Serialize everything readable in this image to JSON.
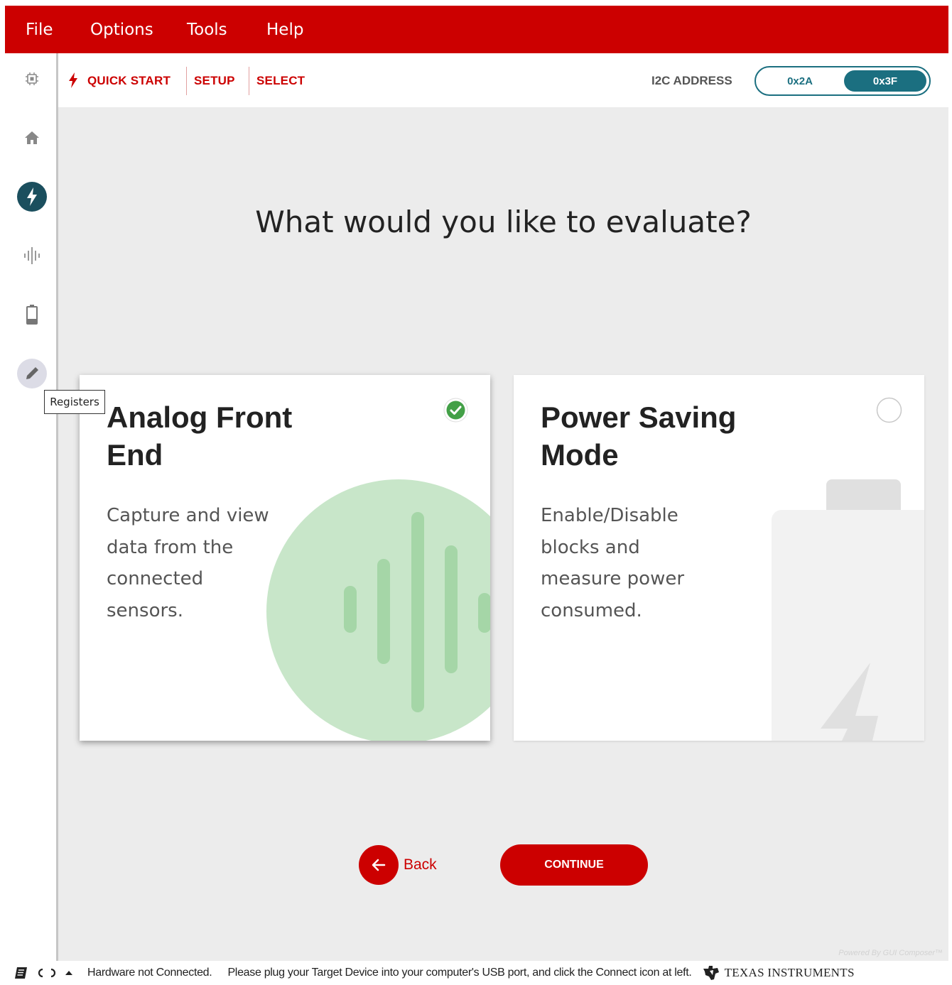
{
  "menu": {
    "items": [
      "File",
      "Options",
      "Tools",
      "Help"
    ]
  },
  "sidebar": {
    "icons": [
      "chip-icon",
      "home-icon",
      "quick-start-icon",
      "waveform-icon",
      "battery-icon",
      "pencil-icon"
    ],
    "tooltip": "Registers"
  },
  "breadcrumb": {
    "quick_start": "QUICK START",
    "setup": "SETUP",
    "select": "SELECT"
  },
  "i2c": {
    "label": "I2C ADDRESS",
    "options": [
      "0x2A",
      "0x3F"
    ],
    "selected": "0x3F"
  },
  "main": {
    "heading": "What would you like to evaluate?"
  },
  "cards": [
    {
      "title": "Analog Front End",
      "description": "Capture and view data from the connected sensors.",
      "selected": true
    },
    {
      "title": "Power Saving Mode",
      "description": "Enable/Disable blocks and measure power consumed.",
      "selected": false
    }
  ],
  "buttons": {
    "back": "Back",
    "continue": "CONTINUE"
  },
  "footer": {
    "powered_by": "Powered By GUI Composer™"
  },
  "status": {
    "message1": "Hardware not Connected.",
    "message2": "Please plug your Target Device into your computer's USB port, and click the Connect icon at left.",
    "brand": "TEXAS INSTRUMENTS"
  },
  "colors": {
    "brand_red": "#cc0000",
    "teal": "#1b6f80",
    "check_green": "#43a047",
    "wave_green": "#c8e6c9"
  }
}
